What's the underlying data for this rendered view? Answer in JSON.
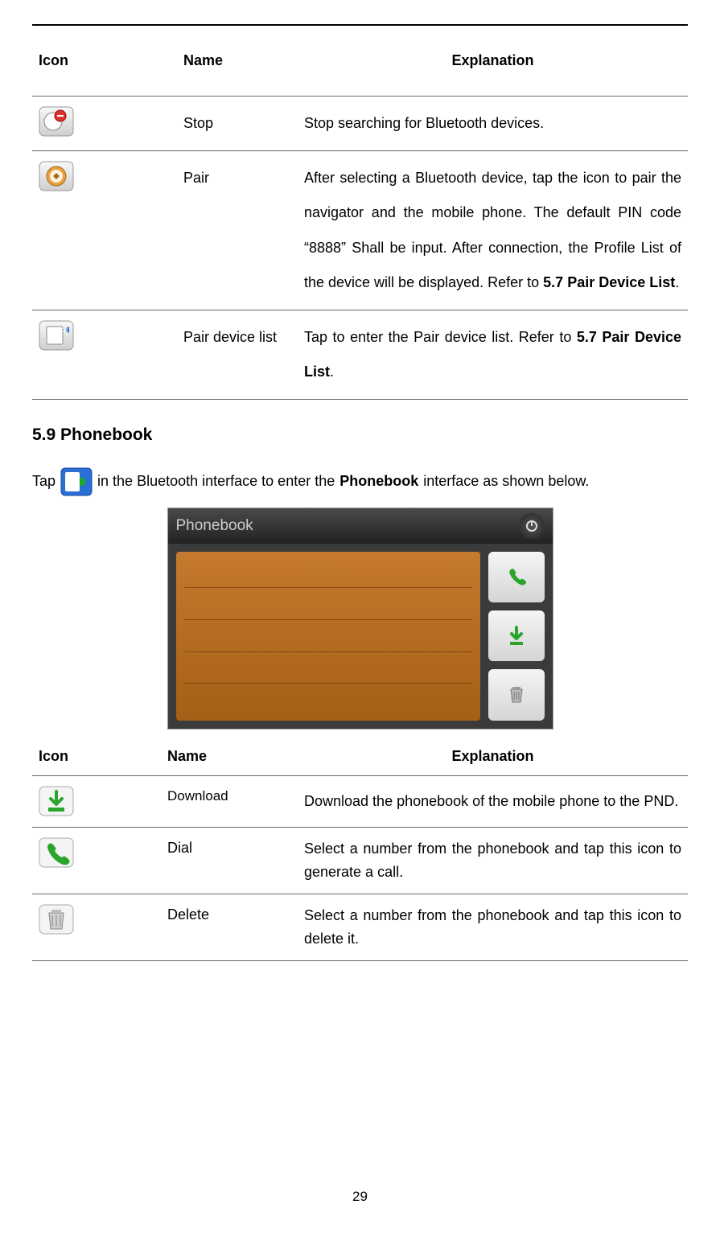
{
  "table1": {
    "headers": {
      "icon": "Icon",
      "name": "Name",
      "explanation": "Explanation"
    },
    "rows": [
      {
        "icon": "stop-icon",
        "name": "Stop",
        "explanation": "Stop searching for Bluetooth devices.",
        "bold_suffix": ""
      },
      {
        "icon": "pair-icon",
        "name": "Pair",
        "explanation": "After selecting a Bluetooth device, tap the icon to pair the navigator and the mobile phone. The default PIN code “8888” Shall be input. After connection, the Profile List of the device will be displayed. Refer to ",
        "bold_suffix": "5.7 Pair Device List",
        "suffix_after": "."
      },
      {
        "icon": "pair-device-list-icon",
        "name": "Pair device list",
        "explanation": "Tap to enter the Pair device list. Refer to ",
        "bold_suffix": "5.7 Pair Device List",
        "suffix_after": "."
      }
    ]
  },
  "section_heading": "5.9 Phonebook",
  "intro": {
    "pre": "Tap ",
    "post_a": " in the Bluetooth interface to enter the ",
    "bold": "Phonebook",
    "post_b": " interface as shown below."
  },
  "screenshot": {
    "title": "Phonebook"
  },
  "table2": {
    "headers": {
      "icon": "Icon",
      "name": "Name",
      "explanation": "Explanation"
    },
    "rows": [
      {
        "icon": "download-icon",
        "name": "Download",
        "explanation": "Download the phonebook of the mobile phone to the PND."
      },
      {
        "icon": "dial-icon",
        "name": "Dial",
        "explanation": "Select a number from the phonebook and tap this icon to generate a call."
      },
      {
        "icon": "delete-icon",
        "name": "Delete",
        "explanation": "Select a number from the phonebook and tap this icon to delete it."
      }
    ]
  },
  "page_number": "29"
}
